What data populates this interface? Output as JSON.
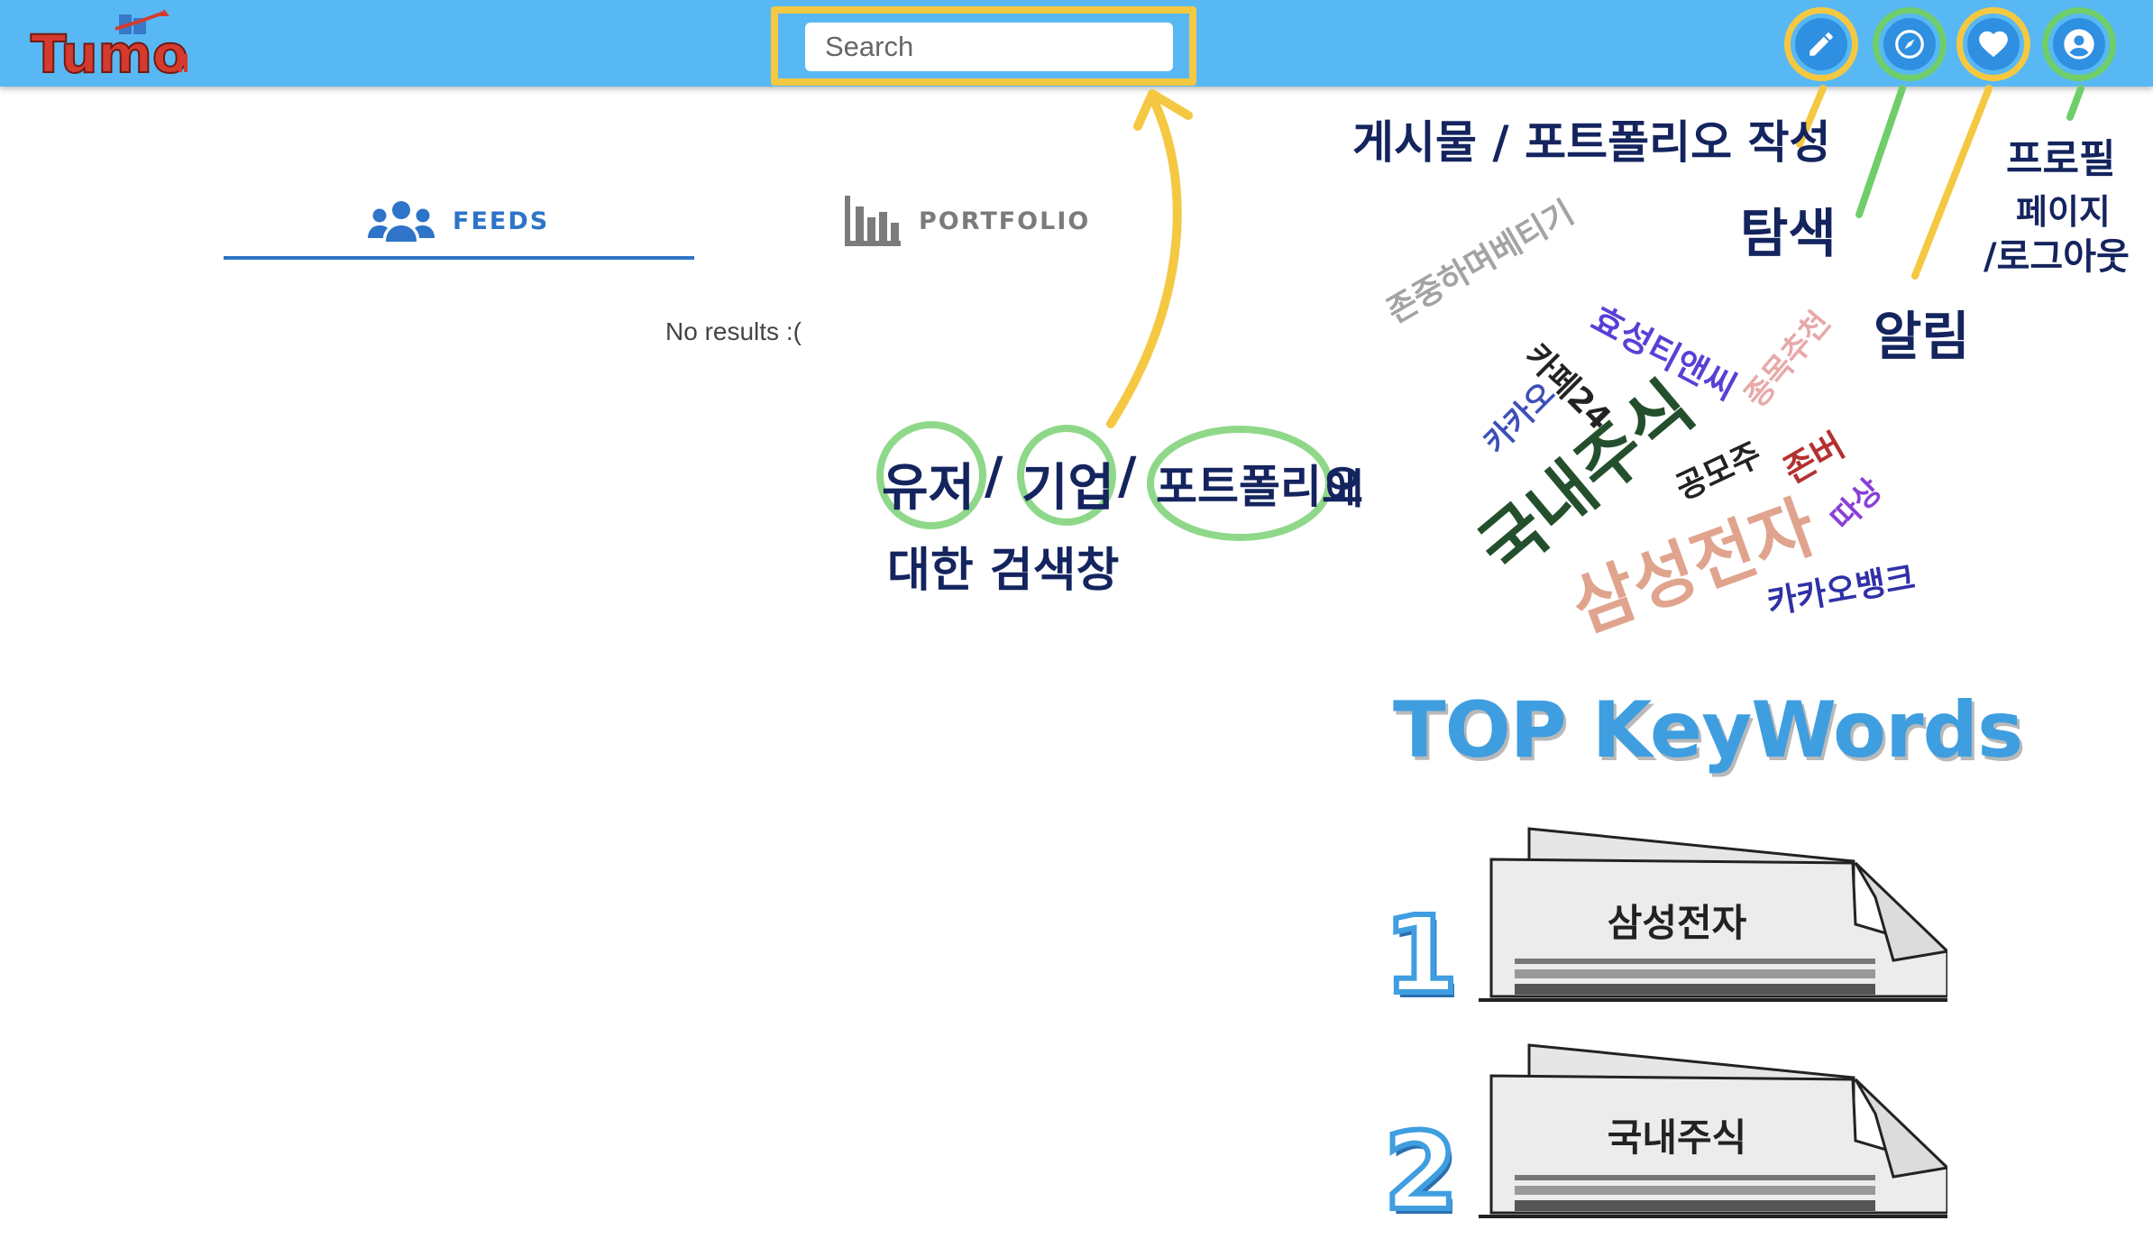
{
  "header": {
    "logo_text": "Tumo",
    "search": {
      "placeholder": "Search",
      "value": ""
    },
    "nav_icons": [
      "pencil-icon",
      "compass-icon",
      "heart-icon",
      "account-icon"
    ]
  },
  "tabs": [
    {
      "label": "FEEDS",
      "icon": "people-icon",
      "active": true
    },
    {
      "label": "PORTFOLIO",
      "icon": "bar-chart-icon",
      "active": false
    }
  ],
  "main": {
    "empty_message": "No results :("
  },
  "annotations": {
    "write_label": "게시물 / 포트폴리오 작성",
    "explore_label": "탐색",
    "alarm_label": "알림",
    "profile_label_1": "프로필",
    "profile_label_2": "페이지",
    "profile_label_3": "/로그아웃",
    "search_desc_user": "유저",
    "search_desc_company": "기업",
    "search_desc_portfolio": "포트폴리오",
    "search_desc_suffix": "에",
    "search_desc_line2": "대한 검색창",
    "slash": "/"
  },
  "word_cloud": [
    "존중하며베티기",
    "카페24",
    "효성티앤씨",
    "종목추천",
    "카카오",
    "국내주식",
    "공모주",
    "존버",
    "삼성전자",
    "따상",
    "카카오뱅크"
  ],
  "top_keywords": {
    "title": "TOP KeyWords",
    "items": [
      {
        "rank": "1",
        "keyword": "삼성전자"
      },
      {
        "rank": "2",
        "keyword": "국내주식"
      }
    ]
  },
  "colors": {
    "header_bg": "#58b8f4",
    "accent_blue": "#2e74c8",
    "highlight_yellow": "#f5c842",
    "highlight_green": "#6fce6a"
  }
}
